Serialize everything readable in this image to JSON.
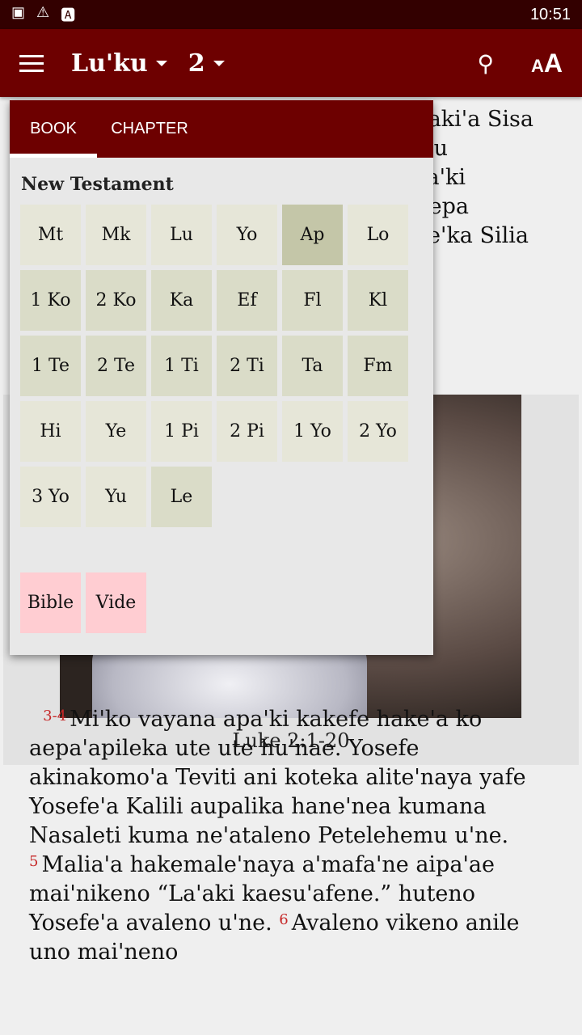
{
  "status_bar": {
    "time": "10:51",
    "icons": [
      "image-icon",
      "warning-icon",
      "font-icon"
    ]
  },
  "app_bar": {
    "book": "Lu'ku",
    "chapter": "2",
    "icons": [
      "menu-icon",
      "search-icon",
      "text-size-icon"
    ],
    "text_size_label": "AA"
  },
  "background_text": {
    "lines": [
      "o aki'a Sisa",
      "Lomu",
      "pa'ki",
      "o aepa",
      "ve'ka Silia"
    ]
  },
  "figure": {
    "caption": "Luke 2:1-20"
  },
  "verses": [
    {
      "num": "3-4",
      "text": "Mi'ko vayana apa'ki kakefe hake'a ko aepa'apileka ute ute hu'nae. Yosefe akinakomo'a Teviti ani koteka alite'naya yafe Yosefe'a Kalili aupalika hane'nea kumana Nasaleti kuma ne'ataleno Petelehemu u'ne."
    },
    {
      "num": "5",
      "text": "Malia'a hakemale'naya a'mafa'ne aipa'ae mai'nikeno “La'aki kaesu'afene.” huteno Yosefe'a avaleno u'ne."
    },
    {
      "num": "6",
      "text": "Avaleno vikeno anile uno mai'neno"
    }
  ],
  "popup": {
    "tabs": [
      {
        "label": "BOOK",
        "active": true
      },
      {
        "label": "CHAPTER",
        "active": false
      }
    ],
    "section": "New Testament",
    "books": [
      {
        "label": "Mt",
        "shade": "light"
      },
      {
        "label": "Mk",
        "shade": "light"
      },
      {
        "label": "Lu",
        "shade": "light"
      },
      {
        "label": "Yo",
        "shade": "light"
      },
      {
        "label": "Ap",
        "shade": "selected"
      },
      {
        "label": "Lo",
        "shade": "light"
      },
      {
        "label": "1 Ko",
        "shade": "dark"
      },
      {
        "label": "2 Ko",
        "shade": "dark"
      },
      {
        "label": "Ka",
        "shade": "dark"
      },
      {
        "label": "Ef",
        "shade": "dark"
      },
      {
        "label": "Fl",
        "shade": "dark"
      },
      {
        "label": "Kl",
        "shade": "dark"
      },
      {
        "label": "1 Te",
        "shade": "dark"
      },
      {
        "label": "2 Te",
        "shade": "dark"
      },
      {
        "label": "1 Ti",
        "shade": "dark"
      },
      {
        "label": "2 Ti",
        "shade": "dark"
      },
      {
        "label": "Ta",
        "shade": "dark"
      },
      {
        "label": "Fm",
        "shade": "dark"
      },
      {
        "label": "Hi",
        "shade": "light"
      },
      {
        "label": "Ye",
        "shade": "light"
      },
      {
        "label": "1 Pi",
        "shade": "light"
      },
      {
        "label": "2 Pi",
        "shade": "light"
      },
      {
        "label": "1 Yo",
        "shade": "light"
      },
      {
        "label": "2 Yo",
        "shade": "light"
      },
      {
        "label": "3 Yo",
        "shade": "light"
      },
      {
        "label": "Yu",
        "shade": "light"
      },
      {
        "label": "Le",
        "shade": "dark"
      }
    ],
    "extras": [
      {
        "label": "Bible"
      },
      {
        "label": "Vide"
      }
    ]
  },
  "colors": {
    "app_bar": "#6d0000",
    "status_bar": "#330000",
    "verse_number": "#c62828",
    "extra_button": "#ffcdd2",
    "selected_book": "#c4c6a8"
  }
}
